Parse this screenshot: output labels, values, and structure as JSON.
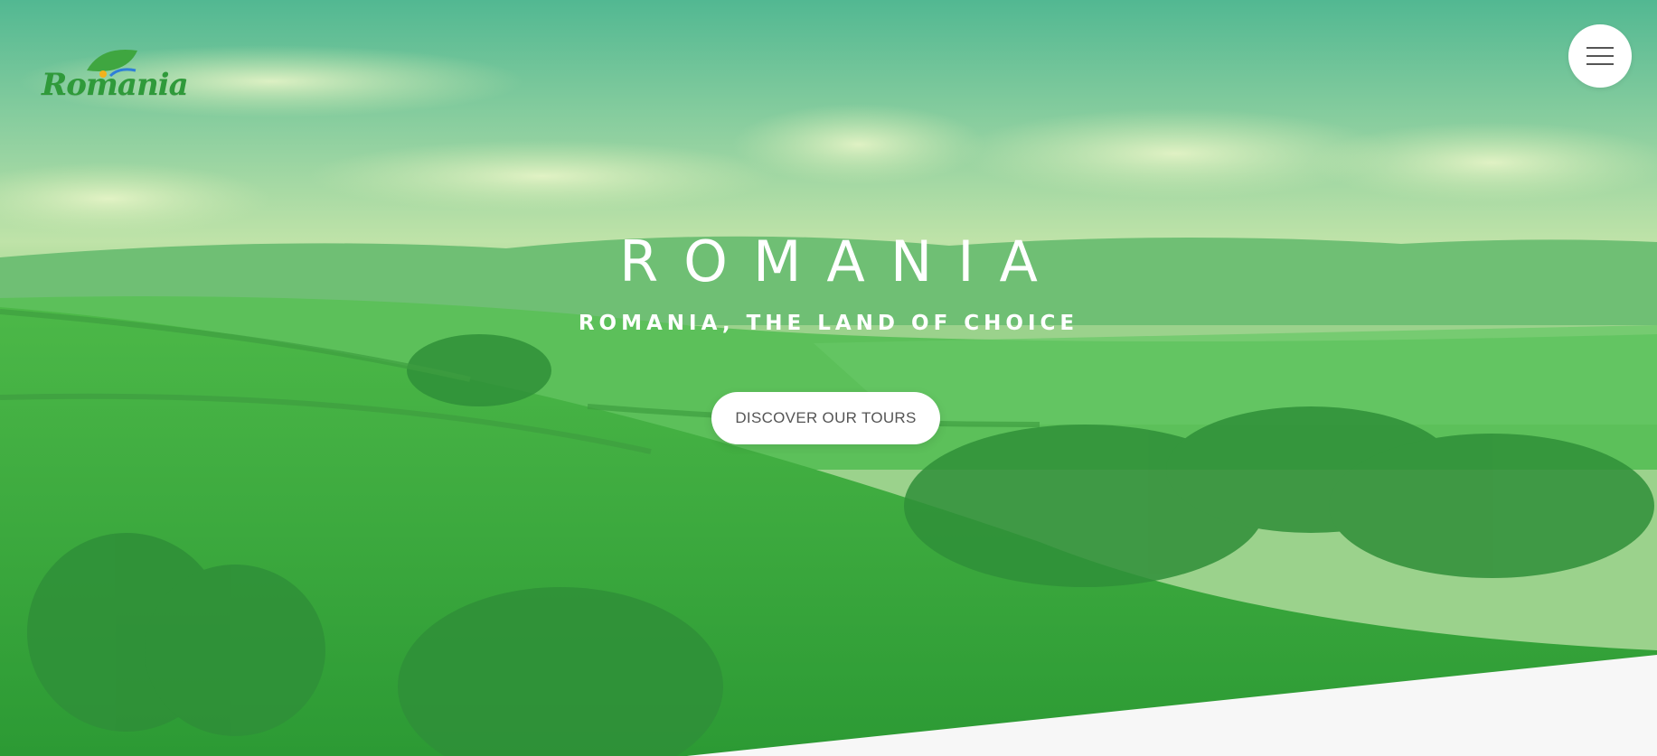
{
  "header": {
    "logo_text": "Romania",
    "menu_icon": "hamburger-menu-icon"
  },
  "hero": {
    "title": "ROMANIA",
    "subtitle": "ROMANIA, THE LAND OF CHOICE",
    "cta_label": "DISCOVER OUR TOURS",
    "background": "green rolling hills landscape with clouds"
  },
  "colors": {
    "overlay_green": "#2fb34a",
    "sky_tint": "#9fd6a4",
    "logo_green": "#2f9a3a",
    "button_bg": "#ffffff",
    "page_bg": "#f7f7f7"
  }
}
